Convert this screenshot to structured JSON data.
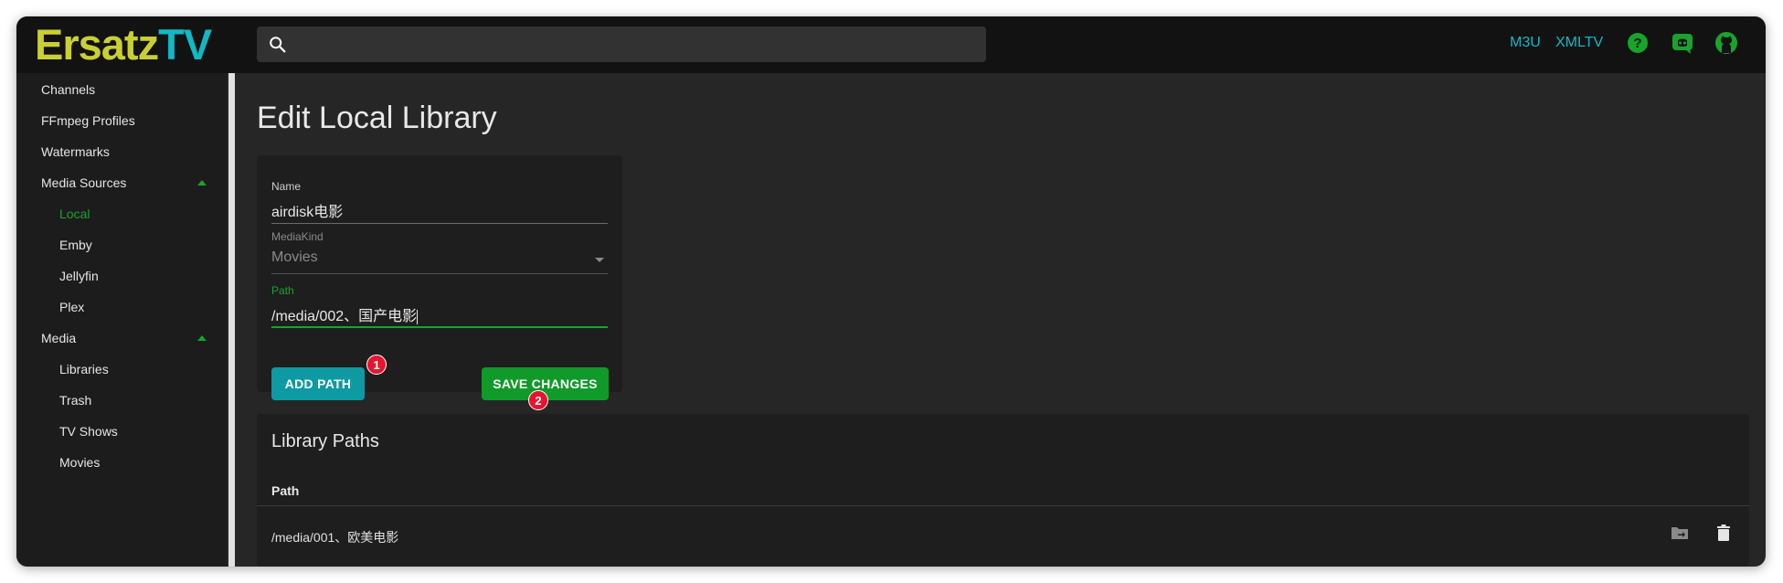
{
  "header": {
    "logo_part1": "Ersatz",
    "logo_part2": "TV",
    "search_placeholder": "",
    "links": {
      "m3u": "M3U",
      "xmltv": "XMLTV"
    },
    "icons": [
      "help-icon",
      "discord-icon",
      "github-icon"
    ],
    "accent_color": "#12b8c4"
  },
  "sidebar": {
    "items": [
      {
        "label": "Channels"
      },
      {
        "label": "FFmpeg Profiles"
      },
      {
        "label": "Watermarks"
      },
      {
        "label": "Media Sources",
        "expanded": true
      },
      {
        "label": "Local",
        "active": true
      },
      {
        "label": "Emby"
      },
      {
        "label": "Jellyfin"
      },
      {
        "label": "Plex"
      },
      {
        "label": "Media",
        "expanded": true
      },
      {
        "label": "Libraries"
      },
      {
        "label": "Trash"
      },
      {
        "label": "TV Shows"
      },
      {
        "label": "Movies"
      }
    ]
  },
  "page": {
    "title": "Edit Local Library"
  },
  "form": {
    "name_label": "Name",
    "name_value": "airdisk电影",
    "mediakind_label": "MediaKind",
    "mediakind_value": "Movies",
    "path_label": "Path",
    "path_value": "/media/002、国产电影",
    "add_path_label": "ADD PATH",
    "save_changes_label": "SAVE CHANGES",
    "badge_1": "1",
    "badge_2": "2"
  },
  "library_paths": {
    "title": "Library Paths",
    "column_header": "Path",
    "rows": [
      {
        "path": "/media/001、欧美电影"
      }
    ]
  }
}
